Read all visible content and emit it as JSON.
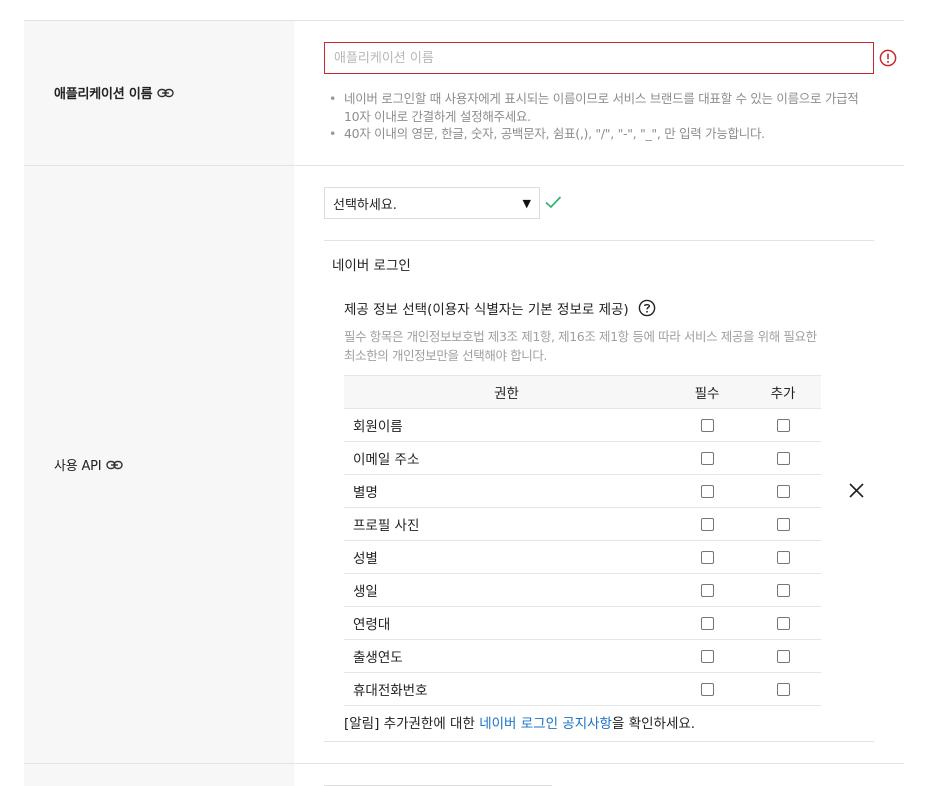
{
  "app_name_row": {
    "label": "애플리케이션 이름",
    "input_placeholder": "애플리케이션 이름",
    "input_value": "",
    "notes": [
      "네이버 로그인할 때 사용자에게 표시되는 이름이므로 서비스 브랜드를 대표할 수 있는 이름으로 가급적 10자 이내로 간결하게 설정해주세요.",
      "40자 이내의 영문, 한글, 숫자, 공백문자, 쉼표(,), \"/\", \"-\", \"_\", 만 입력 가능합니다."
    ]
  },
  "api_row": {
    "label": "사용 API",
    "select_value": "선택하세요.",
    "panel_title": "네이버 로그인",
    "info_title": "제공 정보 선택(이용자 식별자는 기본 정보로 제공)",
    "info_desc": "필수 항목은 개인정보보호법 제3조 제1항, 제16조 제1항 등에 따라 서비스 제공을 위해 필요한 최소한의 개인정보만을 선택해야 합니다.",
    "table": {
      "headers": [
        "권한",
        "필수",
        "추가"
      ],
      "rows": [
        {
          "name": "회원이름",
          "required": false,
          "additional": false
        },
        {
          "name": "이메일 주소",
          "required": false,
          "additional": false
        },
        {
          "name": "별명",
          "required": false,
          "additional": false
        },
        {
          "name": "프로필 사진",
          "required": false,
          "additional": false
        },
        {
          "name": "성별",
          "required": false,
          "additional": false
        },
        {
          "name": "생일",
          "required": false,
          "additional": false
        },
        {
          "name": "연령대",
          "required": false,
          "additional": false
        },
        {
          "name": "출생연도",
          "required": false,
          "additional": false
        },
        {
          "name": "휴대전화번호",
          "required": false,
          "additional": false
        }
      ]
    },
    "notice_prefix": "[알림] 추가권한에 대한 ",
    "notice_link": "네이버 로그인 공지사항",
    "notice_suffix": "을 확인하세요."
  },
  "colors": {
    "error": "#c8282d",
    "valid": "#2db46e",
    "link": "#1a73c9",
    "label_bg": "#f7f7f7"
  },
  "icons": {
    "link": "link-icon",
    "error": "error-circle-icon",
    "valid": "check-icon",
    "help": "help-circle-icon",
    "remove": "close-icon",
    "dropdown": "caret-down-icon"
  }
}
